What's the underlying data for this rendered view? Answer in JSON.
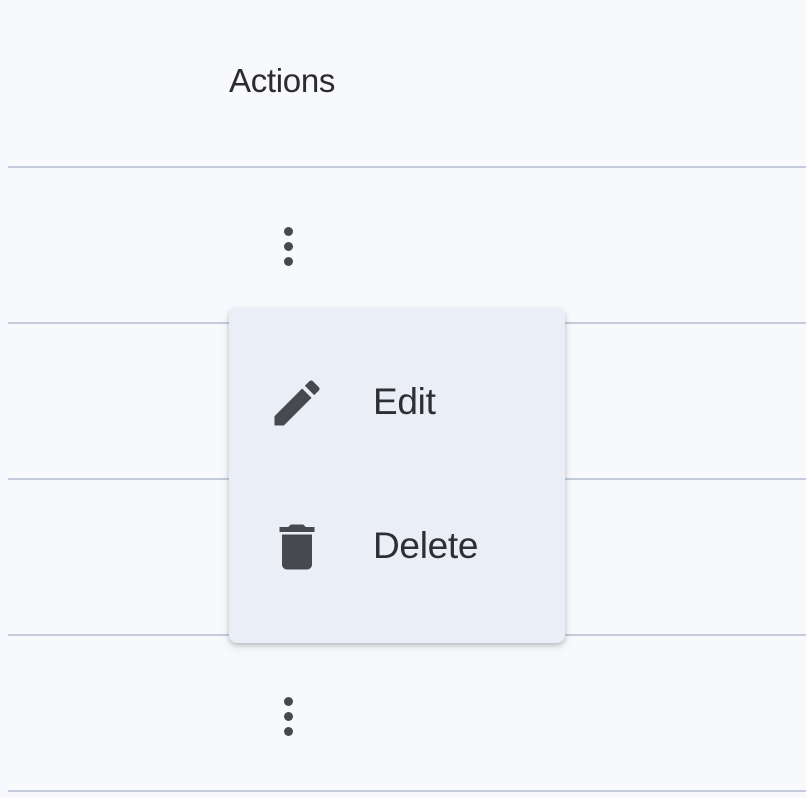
{
  "table": {
    "columns": [
      "Actions"
    ]
  },
  "rows": [
    {
      "actions_icon": "more-vert-icon"
    },
    {
      "actions_icon": null
    },
    {
      "actions_icon": null
    },
    {
      "actions_icon": "more-vert-icon"
    }
  ],
  "menu": {
    "items": [
      {
        "label": "Edit",
        "icon": "pencil-icon"
      },
      {
        "label": "Delete",
        "icon": "trash-icon"
      }
    ]
  },
  "colors": {
    "background": "#f7f9fd",
    "divider": "#c4cddd",
    "menu_background": "#eaeef6",
    "icon": "#48494e",
    "text": "#2f2f33"
  }
}
